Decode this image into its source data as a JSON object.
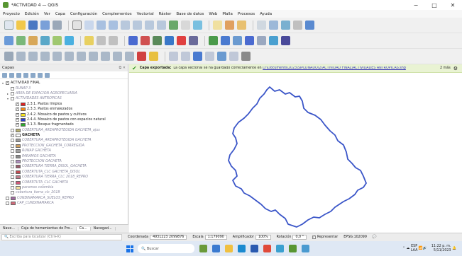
{
  "window": {
    "title": "*ACTIVIDAD 4 — QGIS",
    "min": "−",
    "max": "□",
    "close": "✕"
  },
  "menu": [
    "Proyecto",
    "Edición",
    "Ver",
    "Capa",
    "Configuración",
    "Complementos",
    "Vectorial",
    "Ráster",
    "Base de datos",
    "Web",
    "Malla",
    "Procesos",
    "Ayuda"
  ],
  "layers_panel": {
    "title": "Capas",
    "items": [
      {
        "indent": 0,
        "arrow": "▾",
        "checked": true,
        "swatch": null,
        "label": "ACTIVIDAD FINAL",
        "style": "normal"
      },
      {
        "indent": 1,
        "arrow": "",
        "checked": false,
        "swatch": null,
        "label": "RUNAP 3",
        "style": "dim"
      },
      {
        "indent": 1,
        "arrow": "▸",
        "checked": false,
        "swatch": null,
        "label": "AREA DE EXPACIÓN AGROPECUARIA",
        "style": "dim"
      },
      {
        "indent": 1,
        "arrow": "▾",
        "checked": false,
        "swatch": null,
        "label": "ACTIVIDADES ANTROPICAS",
        "style": "dim"
      },
      {
        "indent": 2,
        "arrow": "",
        "checked": true,
        "swatch": "#e02020",
        "label": "2.3.1. Pastos limpios",
        "style": "normal"
      },
      {
        "indent": 2,
        "arrow": "",
        "checked": true,
        "swatch": "#f08a1a",
        "label": "2.3.3. Pastos enmalezados",
        "style": "normal"
      },
      {
        "indent": 2,
        "arrow": "",
        "checked": true,
        "swatch": "#f3e21c",
        "label": "2.4.2. Mosaico de pastos y cultivos",
        "style": "normal"
      },
      {
        "indent": 2,
        "arrow": "",
        "checked": true,
        "swatch": "#2a3fd0",
        "label": "2.4.4. Mosaico de pastos con espacios natural",
        "style": "normal"
      },
      {
        "indent": 2,
        "arrow": "",
        "checked": true,
        "swatch": "#2ea62e",
        "label": "3.1.3. Bosque fragmentado",
        "style": "normal"
      },
      {
        "indent": 1,
        "arrow": "",
        "checked": false,
        "swatch": "#b8b070",
        "label": "COBERTURA_AREAPROTEGIDA GACHETA_ajus",
        "style": "dim"
      },
      {
        "indent": 1,
        "arrow": "",
        "checked": true,
        "swatch": "#ffffff",
        "label": "GACHETA",
        "style": "bold"
      },
      {
        "indent": 1,
        "arrow": "",
        "checked": false,
        "swatch": "#9c9c9c",
        "label": "COBERTURA_AREAPROTEGIDA GACHETA",
        "style": "dim"
      },
      {
        "indent": 1,
        "arrow": "",
        "checked": false,
        "swatch": "#cfa060",
        "label": "PROTECCIÓN_GACHETA_CORREGIDA",
        "style": "dim"
      },
      {
        "indent": 1,
        "arrow": "",
        "checked": false,
        "swatch": "#a0a0a0",
        "label": "RUNAP GACHETA",
        "style": "dim"
      },
      {
        "indent": 1,
        "arrow": "",
        "checked": false,
        "swatch": "#8a8a8a",
        "label": "PARAMOS GACHETA",
        "style": "dim"
      },
      {
        "indent": 1,
        "arrow": "",
        "checked": false,
        "swatch": "#b090c0",
        "label": "PROTECCION GACHETA",
        "style": "dim"
      },
      {
        "indent": 1,
        "arrow": "",
        "checked": false,
        "swatch": "#9a5a6a",
        "label": "COBERTURA TIERRA_DISOL_GACHETA",
        "style": "dim"
      },
      {
        "indent": 1,
        "arrow": "",
        "checked": false,
        "swatch": "#c04a50",
        "label": "COBERTUTA_CLC GACHETA_DISOL",
        "style": "dim"
      },
      {
        "indent": 1,
        "arrow": "",
        "checked": false,
        "swatch": "#c07a8a",
        "label": "COBERTURA TIERRA_CLC 2018_REPRO",
        "style": "dim"
      },
      {
        "indent": 1,
        "arrow": "",
        "checked": false,
        "swatch": "#d05a7a",
        "label": "COBERTUTA_CLC GACHETA",
        "style": "dim"
      },
      {
        "indent": 1,
        "arrow": "",
        "checked": false,
        "swatch": "#f2e0a0",
        "label": "paramos colombia",
        "style": "dim"
      },
      {
        "indent": 1,
        "arrow": "",
        "checked": false,
        "swatch": null,
        "label": "cobertura_tierra_clc_2018",
        "style": "dim"
      },
      {
        "indent": 0,
        "arrow": "",
        "checked": false,
        "swatch": "#a06aa0",
        "label": "CUNDINAMARCA_SUELOS_REPRO",
        "style": "dim"
      },
      {
        "indent": 0,
        "arrow": "",
        "checked": false,
        "swatch": "#d06a7a",
        "label": "CAP_CUNDINAMARCA",
        "style": "dim"
      }
    ],
    "tabs": [
      "Nave...",
      "Caja de herramientas de Pro...",
      "Ca...",
      "Navegad..."
    ]
  },
  "message_bar": {
    "title": "Capa exportada:",
    "body": "La capa vectorial se ha guardado correctamente en",
    "link": "D:\\Documents\\2023\\SIPLONADO\\2\\ACTIVIDAD FINAL\\ACTIVIDADES ANTROPICAS.shp",
    "time": "2 más"
  },
  "status_bar": {
    "search_placeholder": "Escriba para localizar (Ctrl+K)",
    "coordinate_label": "Coordenada",
    "coordinate_value": "4931223 2099876",
    "scale_label": "Escala",
    "scale_value": "1:179090",
    "magnifier_label": "Amplificador",
    "magnifier_value": "100%",
    "rotation_label": "Rotación",
    "rotation_value": "0,0 °",
    "render_label": "Representar",
    "crs": "EPSG:102099"
  },
  "taskbar": {
    "search_placeholder": "Buscar",
    "lang_top": "ESP",
    "lang_bottom": "LAA",
    "time": "11:22 p. m.",
    "date": "5/11/2023"
  },
  "colors": {
    "boundary_stroke": "#3a55c8",
    "message_bg": "#e9f3d3",
    "accent": "#589632"
  }
}
